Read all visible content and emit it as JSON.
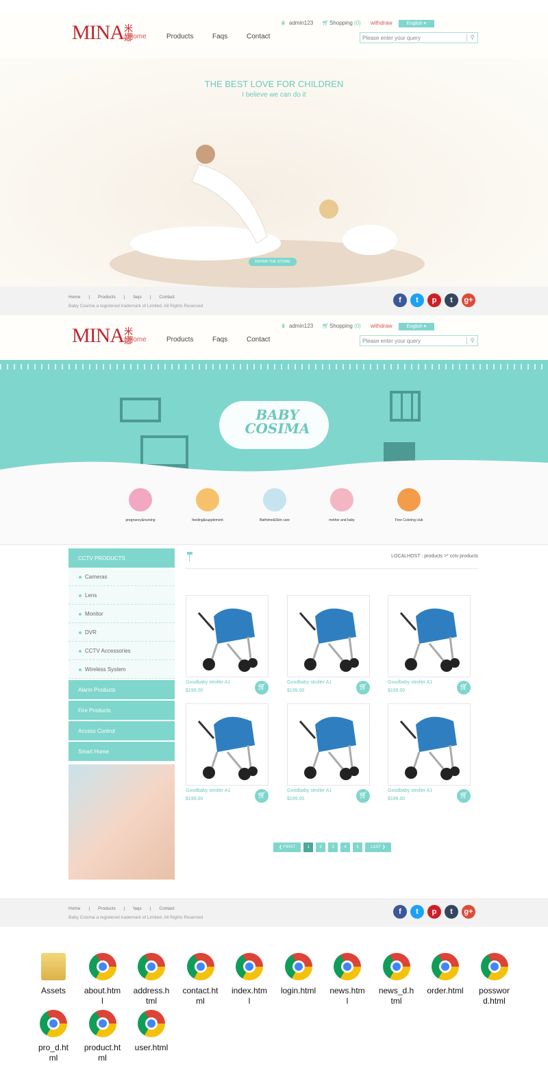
{
  "header": {
    "logo": "MINA",
    "logo_cn": "米娜",
    "nav": [
      "Home",
      "Products",
      "Faqs",
      "Contact"
    ],
    "user": "admin123",
    "shopping": "Shopping",
    "cart_count": "(0)",
    "withdraw": "withdraw",
    "language": "English ▾",
    "search_placeholder": "Please enter your query"
  },
  "hero": {
    "title": "THE BEST LOVE FOR CHILDREN",
    "subtitle": "I believe we can do it",
    "button": "ENTER THE STORE"
  },
  "footer": {
    "links": [
      "Home",
      "Products",
      "faqs",
      "Contact"
    ],
    "copyright": "Baby Cosima a registered trademark of Limited. All Rights Reserved",
    "social": [
      "facebook",
      "twitter",
      "pinterest",
      "tumblr",
      "google-plus"
    ]
  },
  "banner": {
    "title": "BABY COSIMA",
    "categories": [
      "pregnancy&nursing",
      "feeding&supplement",
      "Bathtime&Skin care",
      "mother and baby",
      "Free Coloring club"
    ]
  },
  "sidebar": {
    "header": "CCTV PRODUCTS",
    "items": [
      "Cameras",
      "Lens",
      "Monitor",
      "DVR",
      "CCTV Accessories",
      "Wireless System"
    ],
    "categories": [
      "Alarm Products",
      "Fire Products",
      "Access Control",
      "Smart Home"
    ]
  },
  "breadcrumb": "LOCALHOST : products >* cctv products",
  "products": [
    {
      "name": "Goodbaby stroller A1",
      "price": "$199.00"
    },
    {
      "name": "Goodbaby stroller A1",
      "price": "$199.00"
    },
    {
      "name": "Goodbaby stroller A1",
      "price": "$199.00"
    },
    {
      "name": "Goodbaby stroller A1",
      "price": "$199.00"
    },
    {
      "name": "Goodbaby stroller A1",
      "price": "$199.00"
    },
    {
      "name": "Goodbaby stroller A1",
      "price": "$199.00"
    }
  ],
  "pagination": {
    "first": "❮ FIRST",
    "pages": [
      "1",
      "2",
      "3",
      "4",
      "5"
    ],
    "current": "1",
    "last": "LAST ❯"
  },
  "files": [
    "Assets",
    "about.html",
    "address.html",
    "contact.html",
    "index.html",
    "login.html",
    "news.html",
    "news_d.html",
    "order.html",
    "possword.html",
    "pro_d.html",
    "product.html",
    "user.html"
  ],
  "colors": {
    "accent": "#7fd6cc",
    "nav_active": "#d9534f",
    "logo": "#c0282e"
  }
}
